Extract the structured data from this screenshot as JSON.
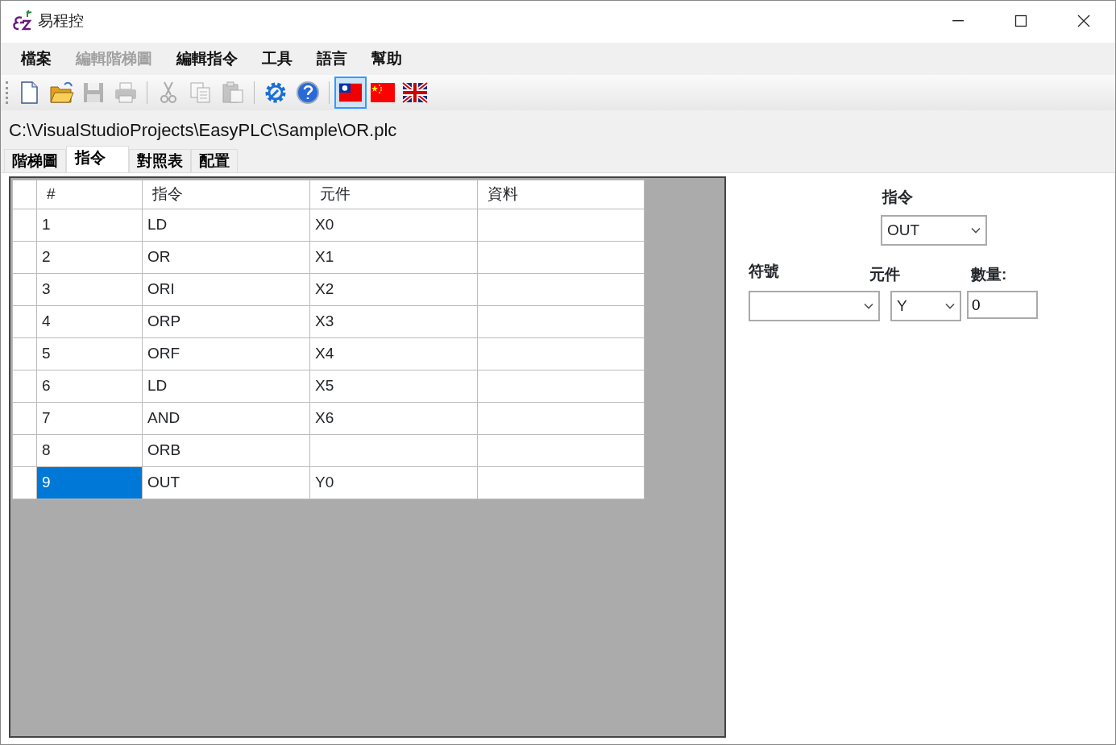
{
  "window": {
    "title": "易程控"
  },
  "menu": [
    {
      "label": "檔案",
      "disabled": false
    },
    {
      "label": "編輯階梯圖",
      "disabled": true
    },
    {
      "label": "編輯指令",
      "disabled": false
    },
    {
      "label": "工具",
      "disabled": false
    },
    {
      "label": "語言",
      "disabled": false
    },
    {
      "label": "幫助",
      "disabled": false
    }
  ],
  "toolbar": {
    "groups": [
      [
        {
          "kind": "new",
          "disabled": false,
          "selected": false
        },
        {
          "kind": "open",
          "disabled": false,
          "selected": false
        },
        {
          "kind": "save",
          "disabled": true,
          "selected": false
        },
        {
          "kind": "print",
          "disabled": true,
          "selected": false
        }
      ],
      [
        {
          "kind": "cut",
          "disabled": true,
          "selected": false
        },
        {
          "kind": "copy",
          "disabled": true,
          "selected": false
        },
        {
          "kind": "paste",
          "disabled": true,
          "selected": false
        }
      ],
      [
        {
          "kind": "settings",
          "disabled": false,
          "selected": false
        },
        {
          "kind": "help",
          "disabled": false,
          "selected": false
        }
      ],
      [
        {
          "kind": "flag_tw",
          "disabled": false,
          "selected": true
        },
        {
          "kind": "flag_cn",
          "disabled": false,
          "selected": false
        },
        {
          "kind": "flag_uk",
          "disabled": false,
          "selected": false
        }
      ]
    ]
  },
  "file_path": "C:\\VisualStudioProjects\\EasyPLC\\Sample\\OR.plc",
  "tabs": [
    {
      "label": "階梯圖",
      "selected": false
    },
    {
      "label": "指令",
      "selected": true
    },
    {
      "label": "對照表",
      "selected": false
    },
    {
      "label": "配置",
      "selected": false
    }
  ],
  "table": {
    "columns": [
      "#",
      "指令",
      "元件",
      "資料"
    ],
    "rows": [
      {
        "cells": [
          "1",
          "LD",
          "X0"
        ],
        "selected": false
      },
      {
        "cells": [
          "2",
          "OR",
          "X1"
        ],
        "selected": false
      },
      {
        "cells": [
          "3",
          "ORI",
          "X2"
        ],
        "selected": false
      },
      {
        "cells": [
          "4",
          "ORP",
          "X3"
        ],
        "selected": false
      },
      {
        "cells": [
          "5",
          "ORF",
          "X4"
        ],
        "selected": false
      },
      {
        "cells": [
          "6",
          "LD",
          "X5"
        ],
        "selected": false
      },
      {
        "cells": [
          "7",
          "AND",
          "X6"
        ],
        "selected": false
      },
      {
        "cells": [
          "8",
          "ORB"
        ],
        "selected": false
      },
      {
        "cells": [
          "9",
          "OUT",
          "Y0"
        ],
        "selected": true
      }
    ]
  },
  "form": {
    "instruction": {
      "label": "指令",
      "value": "OUT"
    },
    "symbol": {
      "label": "符號"
    },
    "device": {
      "label": "元件",
      "value": "Y"
    },
    "count": {
      "label": "數量:",
      "value": "0"
    }
  }
}
